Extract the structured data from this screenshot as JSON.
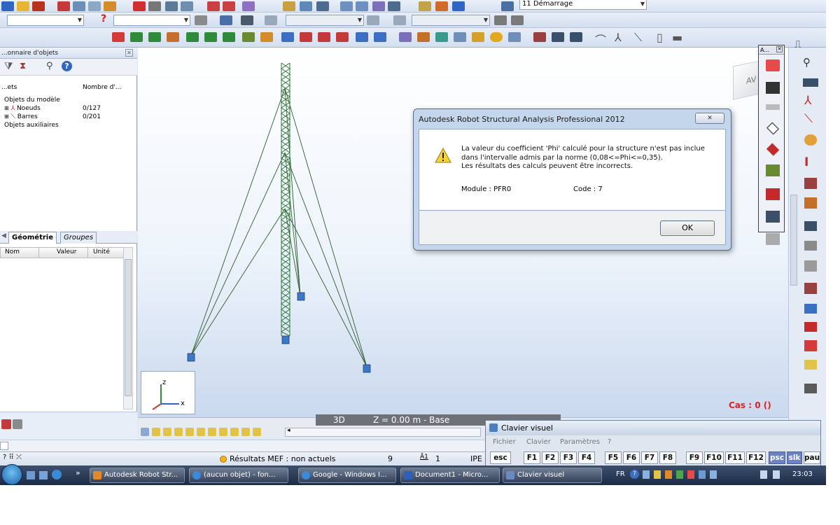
{
  "toolbar": {
    "combo_case_value": "",
    "combo_family_value": "",
    "combo_view_value": "",
    "combo_layout_value": "",
    "combo_layout_label": "11 Démarrage",
    "palette_title": "A..."
  },
  "object_inspector": {
    "title": "...onnaire d'objets",
    "col_objects": "...ets",
    "col_count": "Nombre d'...",
    "tree": [
      {
        "label": "Objets du modèle",
        "count": ""
      },
      {
        "label": "Noeuds",
        "count": "0/127"
      },
      {
        "label": "Barres",
        "count": "0/201"
      },
      {
        "label": "Objets auxiliaires",
        "count": ""
      }
    ],
    "tab_geometry": "Géométrie",
    "tab_groups": "Groupes",
    "col_name": "Nom",
    "col_value": "Valeur",
    "col_unit": "Unité"
  },
  "viewport": {
    "mode": "3D",
    "z_level": "Z = 0.00 m - Base",
    "case_label": "Cas : 0 ()",
    "viewcube_label": "AV",
    "axis_z": "z",
    "axis_x": "x"
  },
  "dialog": {
    "title": "Autodesk Robot Structural Analysis Professional 2012",
    "message_line1": "La valeur du coefficient 'Phi' calculé pour la structure n'est pas inclue",
    "message_line2": "dans l'intervalle admis par la norme (0,08<=Phi<=0,35).",
    "message_line3": "Les résultats des calculs peuvent être incorrects.",
    "module": "Module : PFR0",
    "code": "Code : 7",
    "ok_label": "OK"
  },
  "statusbar": {
    "results": "Résultats MEF : non actuels",
    "field1": "9",
    "field2": "1",
    "field3": "IPE"
  },
  "clavier_visuel": {
    "title": "Clavier visuel",
    "menu": [
      "Fichier",
      "Clavier",
      "Paramètres",
      "?"
    ],
    "keys": [
      "esc",
      "F1",
      "F2",
      "F3",
      "F4",
      "F5",
      "F6",
      "F7",
      "F8",
      "F9",
      "F10",
      "F11",
      "F12",
      "psc",
      "slk",
      "pau"
    ]
  },
  "taskbar": {
    "items": [
      {
        "label": "Autodesk Robot Str..."
      },
      {
        "label": "(aucun objet) - fon..."
      },
      {
        "label": "Google - Windows I..."
      },
      {
        "label": "Document1 - Micro..."
      },
      {
        "label": "Clavier visuel"
      }
    ],
    "language": "FR",
    "clock": "23:03"
  },
  "colors": {
    "accent": "#1d4f9c",
    "tower": "#2e7a3a",
    "cable": "#2f5c2f",
    "support": "#3c78c8",
    "case_text": "#e02020"
  }
}
